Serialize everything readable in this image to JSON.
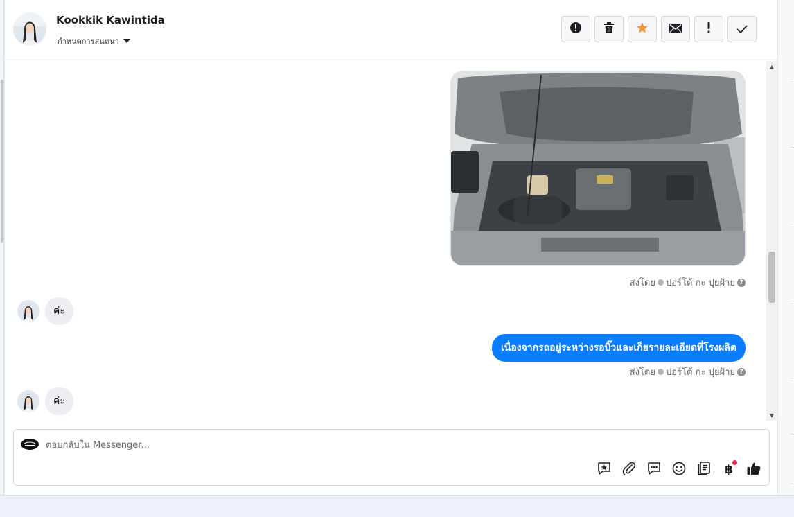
{
  "header": {
    "contact_name": "Kookkik Kawintida",
    "subtitle": "กำหนดการสนทนา"
  },
  "toolbar": [
    {
      "name": "spam-button",
      "icon": "report-icon"
    },
    {
      "name": "delete-button",
      "icon": "trash-icon"
    },
    {
      "name": "star-button",
      "icon": "star-icon",
      "color": "#f7923a"
    },
    {
      "name": "mark-unread-button",
      "icon": "envelope-icon"
    },
    {
      "name": "follow-up-button",
      "icon": "exclamation-icon"
    },
    {
      "name": "mark-done-button",
      "icon": "check-icon"
    }
  ],
  "messages": {
    "photo_sent_by": "ส่งโดย",
    "photo_sender": "ปอร์โต้ กะ ปุยฝ้าย",
    "reply_1": "ค่ะ",
    "outgoing_text": "เนื่องจากรถอยู่ระหว่างรอบิ๊วและเก็ยรายละเอียดที่โรงผลิต",
    "outgoing_sent_by": "ส่งโดย",
    "outgoing_sender": "ปอร์โต้ กะ ปุยฝ้าย",
    "reply_2": "ค่ะ"
  },
  "composer": {
    "placeholder": "ตอบกลับใน Messenger...",
    "currency_symbol": "฿"
  },
  "colors": {
    "outgoing_bubble": "#0a7cff",
    "incoming_bubble": "#eceef1",
    "notification_dot": "#f02849"
  }
}
